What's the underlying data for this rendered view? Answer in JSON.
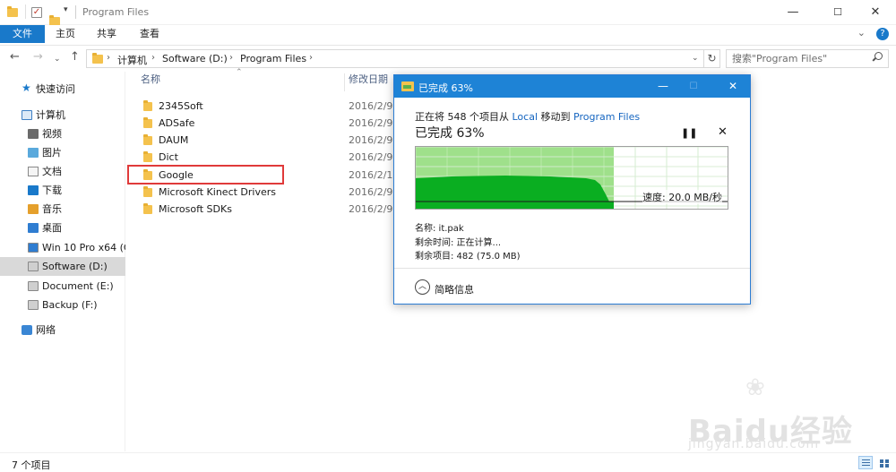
{
  "window": {
    "title": "Program Files"
  },
  "ribbon": {
    "tabs": [
      "文件",
      "主页",
      "共享",
      "查看"
    ]
  },
  "address": {
    "crumbs": [
      "计算机",
      "Software (D:)",
      "Program Files"
    ],
    "search_placeholder": "搜索\"Program Files\""
  },
  "nav": {
    "items": [
      {
        "label": "快速访问",
        "icon": "quick-access-star-icon"
      },
      {
        "label": "计算机",
        "icon": "computer-icon"
      },
      {
        "label": "视频",
        "icon": "videos-folder-icon"
      },
      {
        "label": "图片",
        "icon": "pictures-folder-icon"
      },
      {
        "label": "文档",
        "icon": "documents-folder-icon"
      },
      {
        "label": "下载",
        "icon": "downloads-folder-icon"
      },
      {
        "label": "音乐",
        "icon": "music-folder-icon"
      },
      {
        "label": "桌面",
        "icon": "desktop-folder-icon"
      },
      {
        "label": "Win 10 Pro x64 (C:",
        "icon": "windows-drive-icon"
      },
      {
        "label": "Software (D:)",
        "icon": "drive-icon"
      },
      {
        "label": "Document (E:)",
        "icon": "drive-icon"
      },
      {
        "label": "Backup (F:)",
        "icon": "drive-icon"
      },
      {
        "label": "网络",
        "icon": "network-icon"
      }
    ],
    "selected": "Software (D:)"
  },
  "columns": {
    "name": "名称",
    "date": "修改日期"
  },
  "files": [
    {
      "name": "2345Soft",
      "date": "2016/2/9"
    },
    {
      "name": "ADSafe",
      "date": "2016/2/9"
    },
    {
      "name": "DAUM",
      "date": "2016/2/9"
    },
    {
      "name": "Dict",
      "date": "2016/2/9"
    },
    {
      "name": "Google",
      "date": "2016/2/1"
    },
    {
      "name": "Microsoft Kinect Drivers",
      "date": "2016/2/9"
    },
    {
      "name": "Microsoft SDKs",
      "date": "2016/2/9"
    }
  ],
  "highlighted_file": "Google",
  "status": {
    "count_text": "7 个项目"
  },
  "copy_dialog": {
    "title": "已完成 63%",
    "line_prefix": "正在将 548 个项目从 ",
    "source": "Local",
    "line_mid": " 移动到 ",
    "destination": "Program Files",
    "progress_text": "已完成 63%",
    "progress_value": 0.63,
    "speed_text": "速度: 20.0 MB/秒",
    "name_line": "名称:  it.pak",
    "remaining_time_line": "剩余时间:  正在计算...",
    "remaining_items_line": "剩余项目:  482 (75.0 MB)",
    "details_toggle_label": "简略信息",
    "colors": {
      "title_bar": "#1e83d6",
      "graph_done": "#9fe08b",
      "graph_speed": "#0aae21"
    }
  },
  "watermark": {
    "brand": "Baidu经验",
    "url": "jingyan.baidu.com"
  }
}
